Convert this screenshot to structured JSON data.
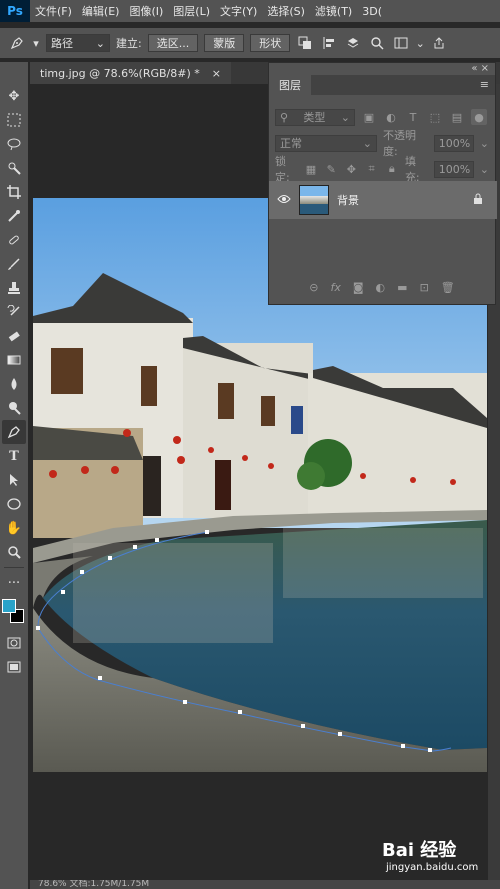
{
  "app": {
    "logo": "Ps"
  },
  "menu": [
    "文件(F)",
    "编辑(E)",
    "图像(I)",
    "图层(L)",
    "文字(Y)",
    "选择(S)",
    "滤镜(T)",
    "3D("
  ],
  "options": {
    "mode_select": "路径",
    "make_label": "建立:",
    "selection_button": "选区...",
    "mask_button": "蒙版",
    "shape_button": "形状"
  },
  "document": {
    "tab_title": "timg.jpg @ 78.6%(RGB/8#) *",
    "close_glyph": "×"
  },
  "status": {
    "text": "78.6%  文档:1.75M/1.75M"
  },
  "layers_panel": {
    "tab_label": "图层",
    "filter_placeholder": "类型",
    "blend_mode": "正常",
    "opacity_label": "不透明度:",
    "opacity_value": "100%",
    "lock_label": "锁定:",
    "fill_label": "填充:",
    "fill_value": "100%",
    "layers": [
      {
        "name": "背景",
        "visible": true,
        "locked": true
      }
    ]
  },
  "colors": {
    "foreground": "#29a3c9",
    "background": "#000000",
    "accent": "#31a8ff"
  },
  "watermark": {
    "brand": "Bai 经验",
    "url": "jingyan.baidu.com"
  },
  "icons": [
    "pen-tool-icon",
    "move-icon",
    "marquee-icon",
    "lasso-icon",
    "quick-select-icon",
    "crop-icon",
    "eyedropper-icon",
    "healing-icon",
    "brush-icon",
    "stamp-icon",
    "history-brush-icon",
    "eraser-icon",
    "gradient-icon",
    "blur-icon",
    "dodge-icon",
    "pen-icon",
    "type-icon",
    "path-select-icon",
    "ellipse-icon",
    "hand-icon",
    "zoom-icon",
    "more-icon",
    "eye-icon",
    "lock-icon"
  ]
}
